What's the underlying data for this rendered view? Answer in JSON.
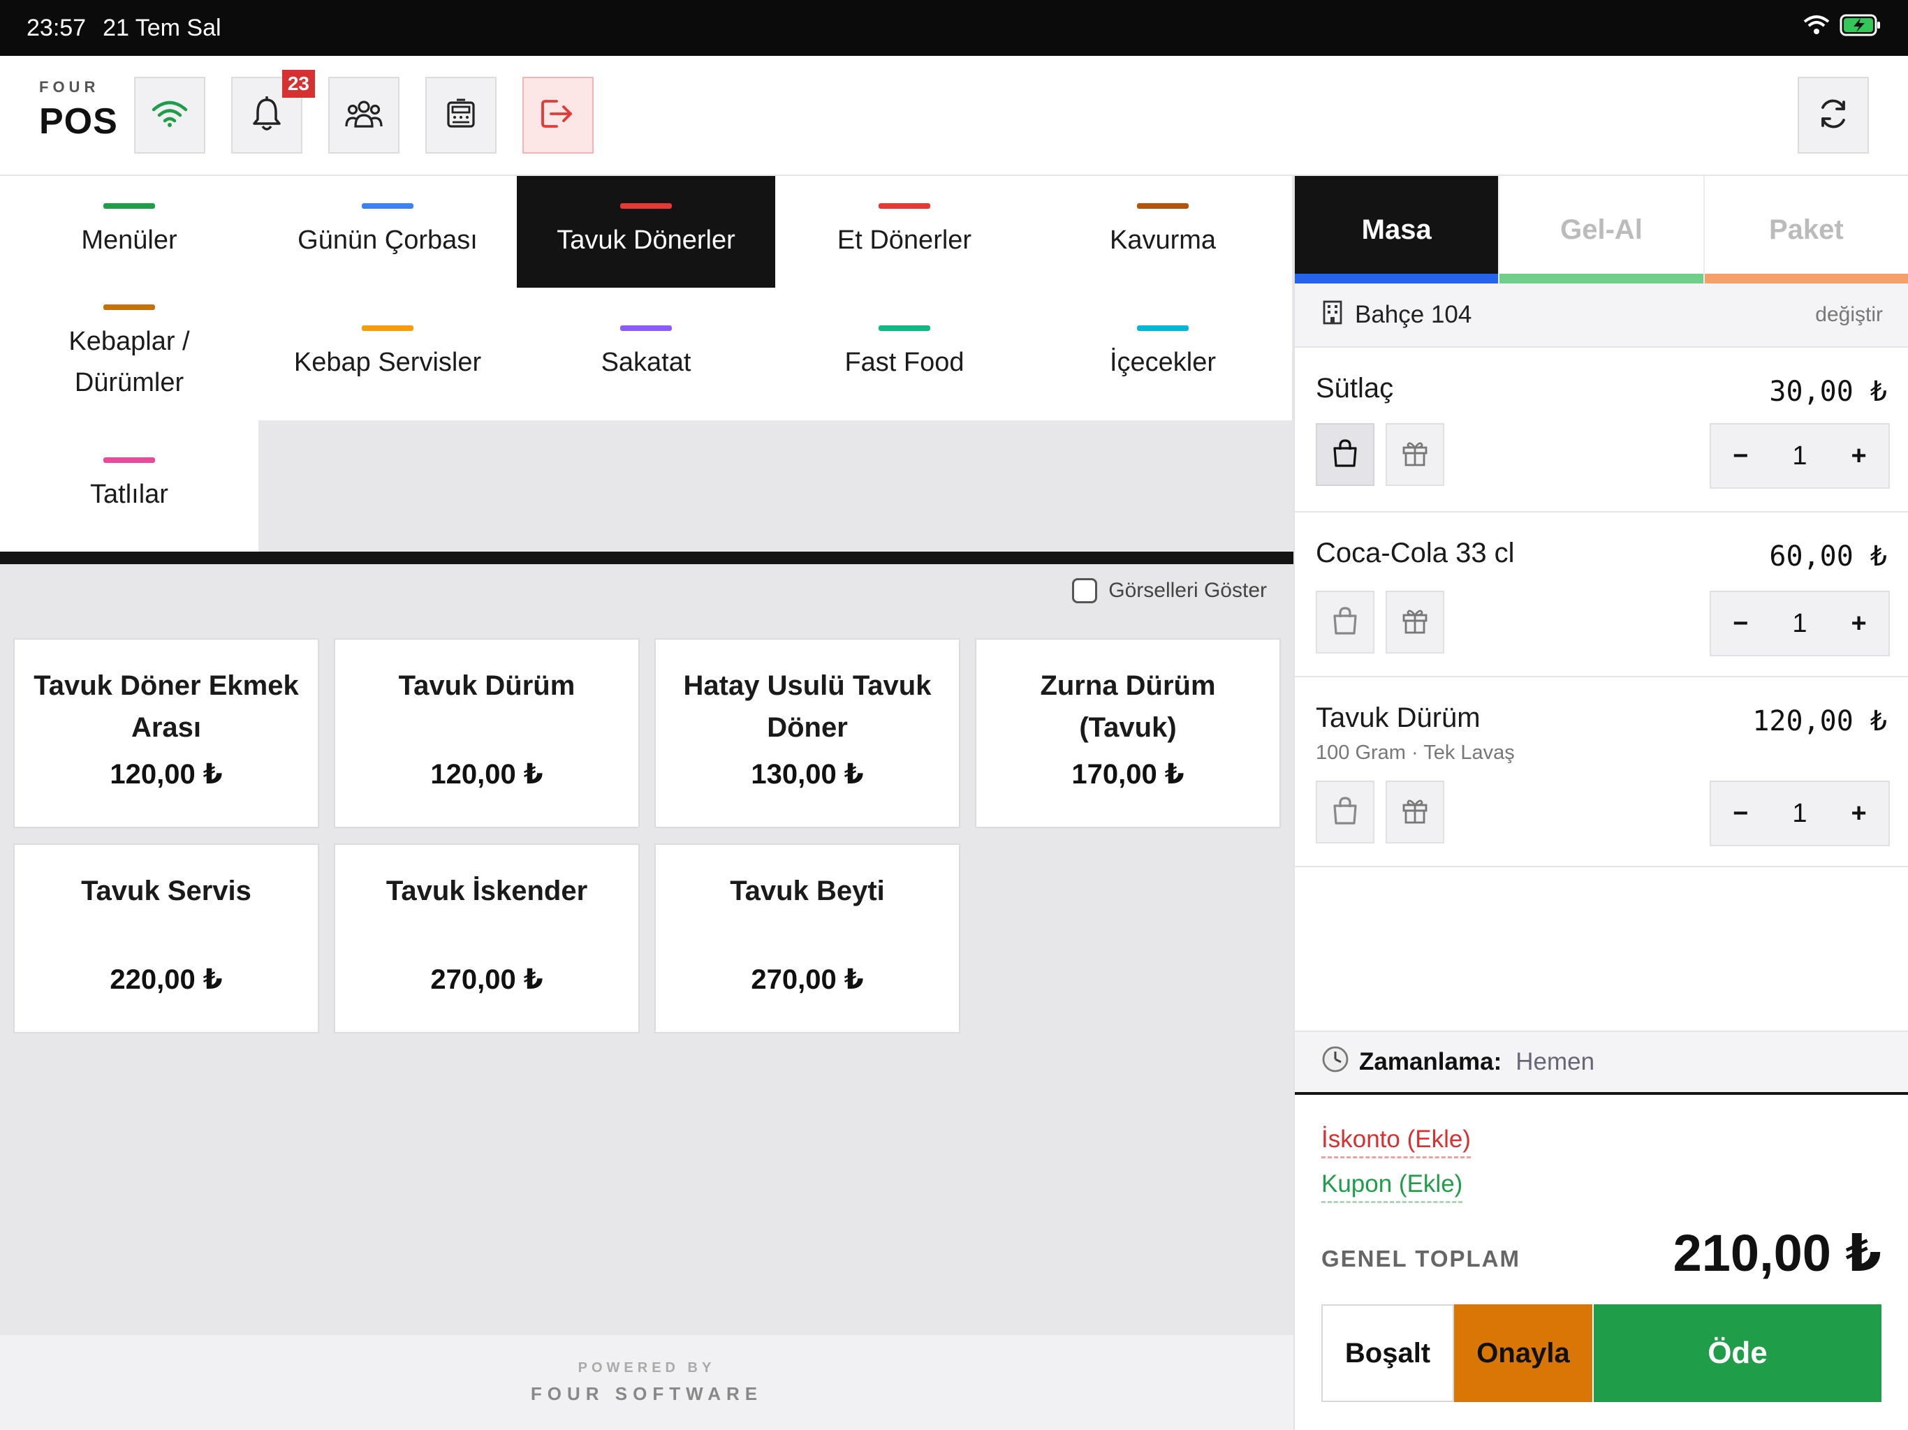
{
  "status": {
    "time": "23:57",
    "date": "21 Tem Sal"
  },
  "brand": {
    "small": "FOUR",
    "big": "POS"
  },
  "toolbar": {
    "notification_count": "23",
    "icons": [
      "wifi-icon",
      "bell-icon",
      "users-icon",
      "cash-register-icon",
      "logout-icon",
      "refresh-icon"
    ]
  },
  "categories": [
    {
      "label": "Menüler",
      "color": "#1f9d49"
    },
    {
      "label": "Günün Çorbası",
      "color": "#3b82f6"
    },
    {
      "label": "Tavuk Dönerler",
      "color": "#e53935"
    },
    {
      "label": "Et Dönerler",
      "color": "#e53935"
    },
    {
      "label": "Kavurma",
      "color": "#b45309"
    },
    {
      "label": "Kebaplar /\nDürümler",
      "color": "#c2710c"
    },
    {
      "label": "Kebap Servisler",
      "color": "#f59e0b"
    },
    {
      "label": "Sakatat",
      "color": "#8b5cf6"
    },
    {
      "label": "Fast Food",
      "color": "#10b981"
    },
    {
      "label": "İçecekler",
      "color": "#06b6d4"
    },
    {
      "label": "Tatlılar",
      "color": "#ec4899"
    }
  ],
  "show_images_label": "Görselleri Göster",
  "products": [
    {
      "name": "Tavuk Döner Ekmek Arası",
      "price": "120,00 ₺"
    },
    {
      "name": "Tavuk Dürüm",
      "price": "120,00 ₺"
    },
    {
      "name": "Hatay Usulü Tavuk Döner",
      "price": "130,00 ₺"
    },
    {
      "name": "Zurna Dürüm (Tavuk)",
      "price": "170,00 ₺"
    },
    {
      "name": "Tavuk Servis",
      "price": "220,00 ₺"
    },
    {
      "name": "Tavuk İskender",
      "price": "270,00 ₺"
    },
    {
      "name": "Tavuk Beyti",
      "price": "270,00 ₺"
    }
  ],
  "footer": {
    "powered": "POWERED BY",
    "company": "FOUR SOFTWARE"
  },
  "order_tabs": [
    {
      "label": "Masa",
      "color": "#2563eb"
    },
    {
      "label": "Gel-Al",
      "color": "#6fcf8a"
    },
    {
      "label": "Paket",
      "color": "#f4a068"
    }
  ],
  "table": {
    "name": "Bahçe 104",
    "change": "değiştir"
  },
  "order_items": [
    {
      "name": "Sütlaç",
      "sub": "",
      "price": "30,00 ₺",
      "qty": "1"
    },
    {
      "name": "Coca-Cola 33 cl",
      "sub": "",
      "price": "60,00 ₺",
      "qty": "1"
    },
    {
      "name": "Tavuk Dürüm",
      "sub": "100 Gram · Tek Lavaş",
      "price": "120,00 ₺",
      "qty": "1"
    }
  ],
  "stepper": {
    "minus": "−",
    "plus": "+"
  },
  "schedule": {
    "label": "Zamanlama:",
    "value": "Hemen"
  },
  "discount_label": "İskonto (Ekle)",
  "coupon_label": "Kupon (Ekle)",
  "total": {
    "label": "GENEL TOPLAM",
    "value": "210,00 ₺"
  },
  "actions": {
    "clear": "Boşalt",
    "confirm": "Onayla",
    "pay": "Öde"
  }
}
